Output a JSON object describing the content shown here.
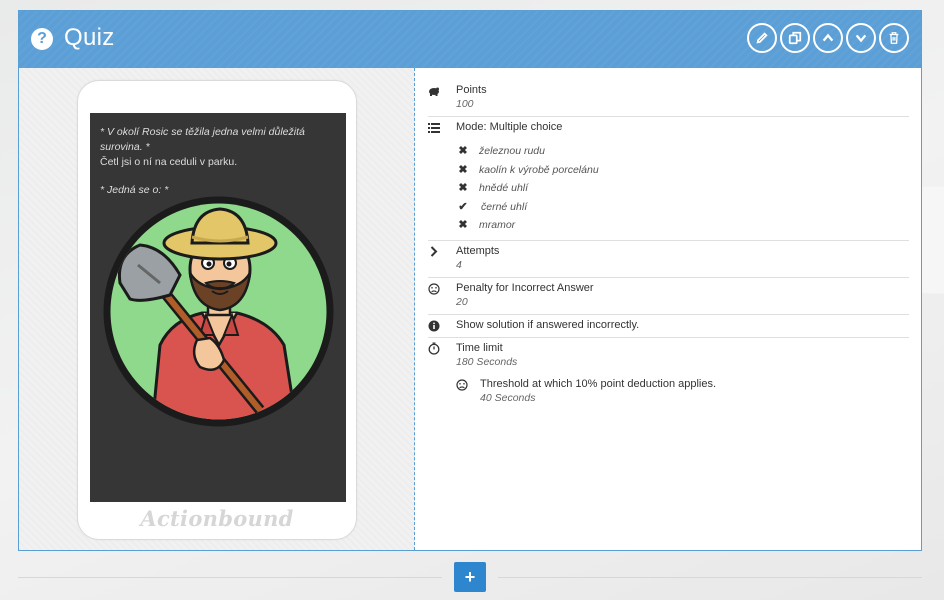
{
  "header": {
    "title": "Quiz",
    "icon": "question-circle-icon",
    "buttons": [
      {
        "name": "edit-button",
        "icon": "pencil-icon"
      },
      {
        "name": "duplicate-button",
        "icon": "copy-icon"
      },
      {
        "name": "move-up-button",
        "icon": "chevron-up-icon"
      },
      {
        "name": "move-down-button",
        "icon": "chevron-down-icon"
      },
      {
        "name": "delete-button",
        "icon": "trash-icon"
      }
    ]
  },
  "preview": {
    "question_line1": "* V okolí Rosic se těžila jedna velmi důležitá surovina. *",
    "question_line2": "Četl jsi o ní na ceduli v parku.",
    "question_line3": "* Jedná se o: *",
    "brand": "Actionbound"
  },
  "details": {
    "points_label": "Points",
    "points_value": "100",
    "mode_label": "Mode: Multiple choice",
    "answers": [
      {
        "text": "železnou rudu",
        "correct": false
      },
      {
        "text": "kaolín k výrobě porcelánu",
        "correct": false
      },
      {
        "text": "hnědé uhlí",
        "correct": false
      },
      {
        "text": "černé uhlí",
        "correct": true
      },
      {
        "text": "mramor",
        "correct": false
      }
    ],
    "attempts_label": "Attempts",
    "attempts_value": "4",
    "penalty_label": "Penalty for Incorrect Answer",
    "penalty_value": "20",
    "solution_label": "Show solution if answered incorrectly.",
    "time_label": "Time limit",
    "time_value": "180 Seconds",
    "threshold_label": "Threshold at which 10% point deduction applies.",
    "threshold_value": "40 Seconds"
  },
  "footer": {
    "add_label": "+"
  },
  "colors": {
    "header": "#5b9fd6",
    "add_button": "#2e86cf"
  }
}
